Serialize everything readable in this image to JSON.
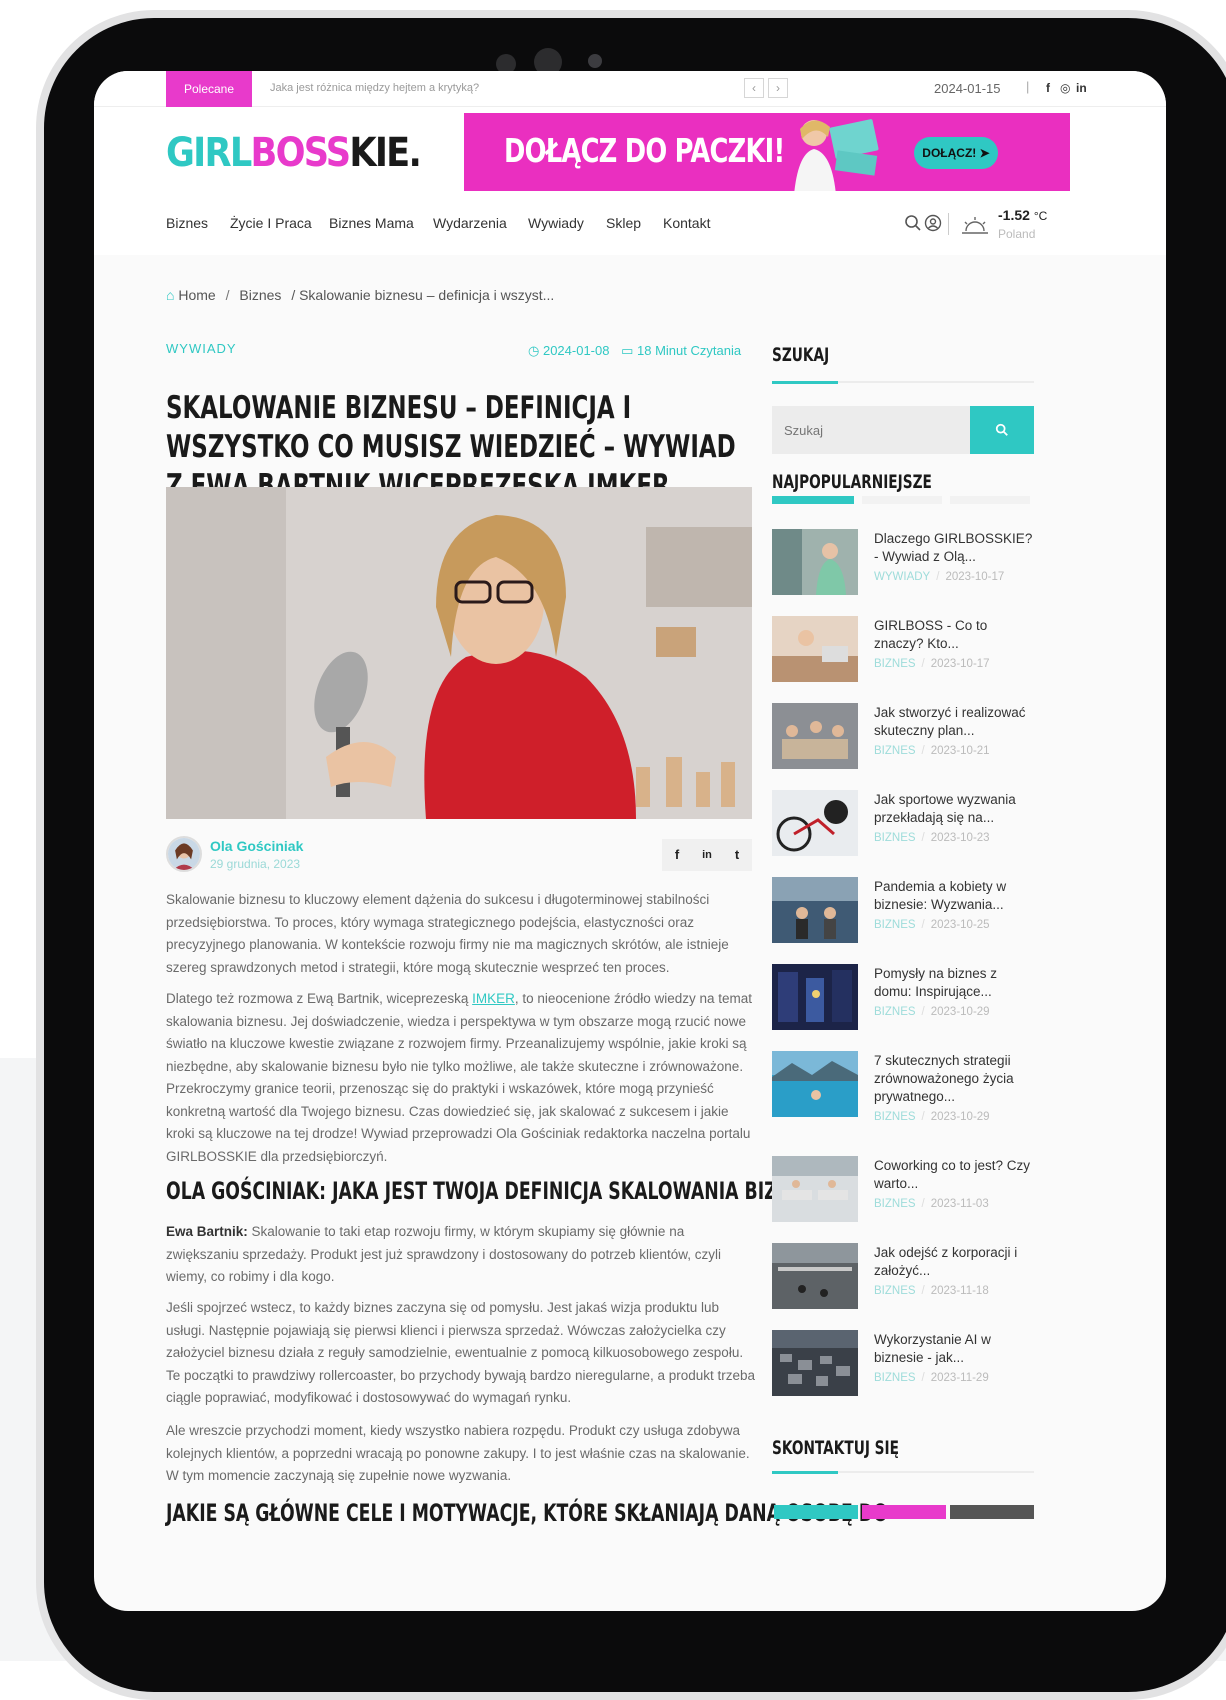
{
  "topbar": {
    "featured_label": "Polecane",
    "ticker": "Jaka jest różnica między hejtem a krytyką?",
    "prev_arrow": "‹",
    "next_arrow": "›",
    "date": "2024-01-15",
    "separator": "|",
    "social": [
      "f",
      "◎",
      "in"
    ]
  },
  "logo": {
    "part1": "GIRL",
    "part2": "BOSS",
    "part3": "KIE."
  },
  "banner": {
    "text": "DOŁĄCZ DO PACZKI!",
    "cta": "DOŁĄCZ! ➤"
  },
  "nav": {
    "items": [
      "Biznes",
      "Życie I Praca",
      "Biznes Mama",
      "Wydarzenia",
      "Wywiady",
      "Sklep",
      "Kontakt"
    ]
  },
  "weather": {
    "temp": "-1.52",
    "unit": "°C",
    "location": "Poland"
  },
  "breadcrumb": {
    "home": "Home",
    "sep": "/",
    "category": "Biznes",
    "current": "/ Skalowanie biznesu – definicja i wszyst..."
  },
  "article": {
    "category": "WYWIADY",
    "date": "2024-01-08",
    "read_time": "18 Minut Czytania",
    "title": "SKALOWANIE BIZNESU – DEFINICJA I WSZYSTKO CO MUSISZ WIEDZIEĆ – WYWIAD Z EWĄ BARTNIK WICEPREZESKĄ IMKER",
    "author": {
      "name": "Ola Gościniak",
      "date": "29 grudnia, 2023"
    },
    "share": [
      "f",
      "in",
      "t"
    ],
    "p1": "Skalowanie biznesu to kluczowy element dążenia do sukcesu i długoterminowej stabilności przedsiębiorstwa. To proces, który wymaga strategicznego podejścia, elastyczności oraz precyzyjnego planowania. W kontekście rozwoju firmy nie ma magicznych skrótów, ale istnieje szereg sprawdzonych metod i strategii, które mogą skutecznie wesprzeć ten proces.",
    "p2_before": "Dlatego też rozmowa z Ewą Bartnik, wiceprezeską ",
    "p2_link": "IMKER",
    "p2_after": ", to nieocenione źródło wiedzy na temat skalowania biznesu. Jej doświadczenie, wiedza i perspektywa w tym obszarze mogą rzucić nowe światło na kluczowe kwestie związane z rozwojem firmy. Przeanalizujemy wspólnie, jakie kroki są niezbędne, aby skalowanie biznesu było nie tylko możliwe, ale także skuteczne i zrównoważone. Przekroczymy granice teorii, przenosząc się do praktyki i wskazówek, które mogą przynieść konkretną wartość dla Twojego biznesu. Czas dowiedzieć się, jak skalować z sukcesem i jakie kroki są kluczowe na tej drodze! Wywiad przeprowadzi Ola Gościniak redaktorka naczelna portalu GIRLBOSSKIE dla przedsiębiorczyń.",
    "h2_1": "OLA GOŚCINIAK: JAKA JEST TWOJA DEFINICJA SKALOWANIA BIZNESU?",
    "p3_speaker": "Ewa Bartnik:",
    "p3": " Skalowanie to taki etap rozwoju firmy, w którym skupiamy się głównie na zwiększaniu sprzedaży. Produkt jest już sprawdzony i dostosowany do potrzeb klientów, czyli wiemy, co robimy i dla kogo.",
    "p4": "Jeśli spojrzeć wstecz, to każdy biznes zaczyna się od pomysłu. Jest jakaś wizja produktu lub usługi. Następnie pojawiają się pierwsi klienci i pierwsza sprzedaż. Wówczas założycielka czy założyciel biznesu działa z reguły samodzielnie, ewentualnie z pomocą kilkuosobowego zespołu. Te początki to prawdziwy rollercoaster, bo przychody bywają bardzo nieregularne, a produkt trzeba ciągle poprawiać, modyfikować i dostosowywać do wymagań rynku.",
    "p5": "Ale wreszcie przychodzi moment, kiedy wszystko nabiera rozpędu. Produkt czy usługa zdobywa kolejnych klientów, a poprzedni wracają po ponowne zakupy. I to jest właśnie czas na skalowanie. W tym momencie zaczynają się zupełnie nowe wyzwania.",
    "h2_2": "JAKIE SĄ GŁÓWNE CELE I MOTYWACJE, KTÓRE SKŁANIAJĄ DANĄ OSOBĘ DO"
  },
  "sidebar": {
    "search_title": "SZUKAJ",
    "search_placeholder": "Szukaj",
    "popular_title": "NAJPOPULARNIEJSZE",
    "popular": [
      {
        "title": "Dlaczego GIRLBOSSKIE? - Wywiad z Olą...",
        "cat": "WYWIADY",
        "date": "2023-10-17"
      },
      {
        "title": "GIRLBOSS - Co to znaczy? Kto...",
        "cat": "BIZNES",
        "date": "2023-10-17"
      },
      {
        "title": "Jak stworzyć i realizować skuteczny plan...",
        "cat": "BIZNES",
        "date": "2023-10-21"
      },
      {
        "title": "Jak sportowe wyzwania przekładają się na...",
        "cat": "BIZNES",
        "date": "2023-10-23"
      },
      {
        "title": "Pandemia a kobiety w biznesie: Wyzwania...",
        "cat": "BIZNES",
        "date": "2023-10-25"
      },
      {
        "title": "Pomysły na biznes z domu: Inspirujące...",
        "cat": "BIZNES",
        "date": "2023-10-29"
      },
      {
        "title": "7 skutecznych strategii zrównoważonego życia prywatnego...",
        "cat": "BIZNES",
        "date": "2023-10-29"
      },
      {
        "title": "Coworking co to jest? Czy warto...",
        "cat": "BIZNES",
        "date": "2023-11-03"
      },
      {
        "title": "Jak odejść z korporacji i założyć...",
        "cat": "BIZNES",
        "date": "2023-11-18"
      },
      {
        "title": "Wykorzystanie AI w biznesie - jak...",
        "cat": "BIZNES",
        "date": "2023-11-29"
      }
    ],
    "contact_title": "SKONTAKTUJ SIĘ"
  },
  "colors": {
    "accent": "#2fc8c3",
    "brand_pink": "#e83acb",
    "dark": "#1a1a1a"
  }
}
